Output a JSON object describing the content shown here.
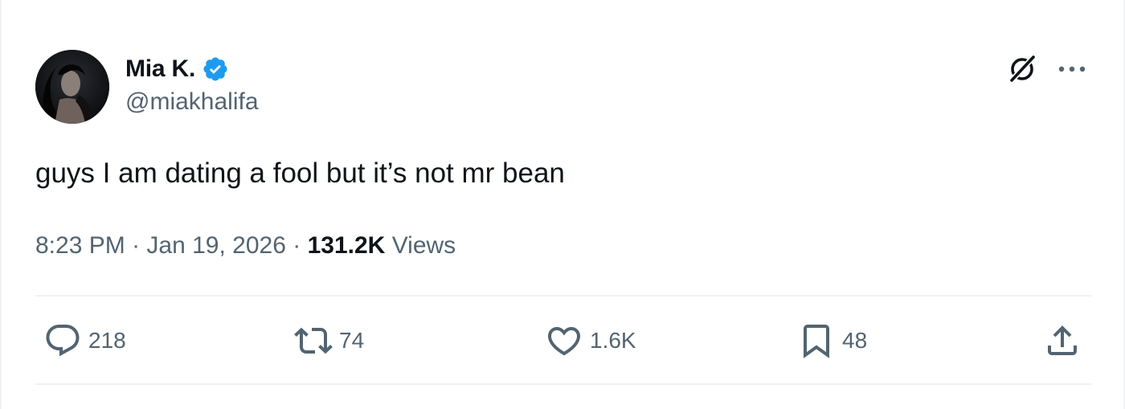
{
  "author": {
    "display_name": "Mia K.",
    "handle": "@miakhalifa",
    "verified": true,
    "verified_color": "#1d9bf0"
  },
  "tweet": {
    "text": "guys I am dating a fool but it’s not mr bean",
    "time": "8:23 PM",
    "separator": "·",
    "date": "Jan 19, 2026",
    "views_count": "131.2K",
    "views_label": "Views"
  },
  "actions": {
    "replies": "218",
    "reposts": "74",
    "likes": "1.6K",
    "bookmarks": "48"
  },
  "icons": {
    "avatar": "profile-photo",
    "verified": "verified-badge-icon",
    "grok": "grok-icon",
    "more": "more-icon",
    "reply": "reply-icon",
    "repost": "repost-icon",
    "like": "heart-icon",
    "bookmark": "bookmark-icon",
    "share": "share-icon"
  },
  "colors": {
    "text_primary": "#0f1419",
    "text_secondary": "#536471",
    "divider": "#eff3f4"
  }
}
